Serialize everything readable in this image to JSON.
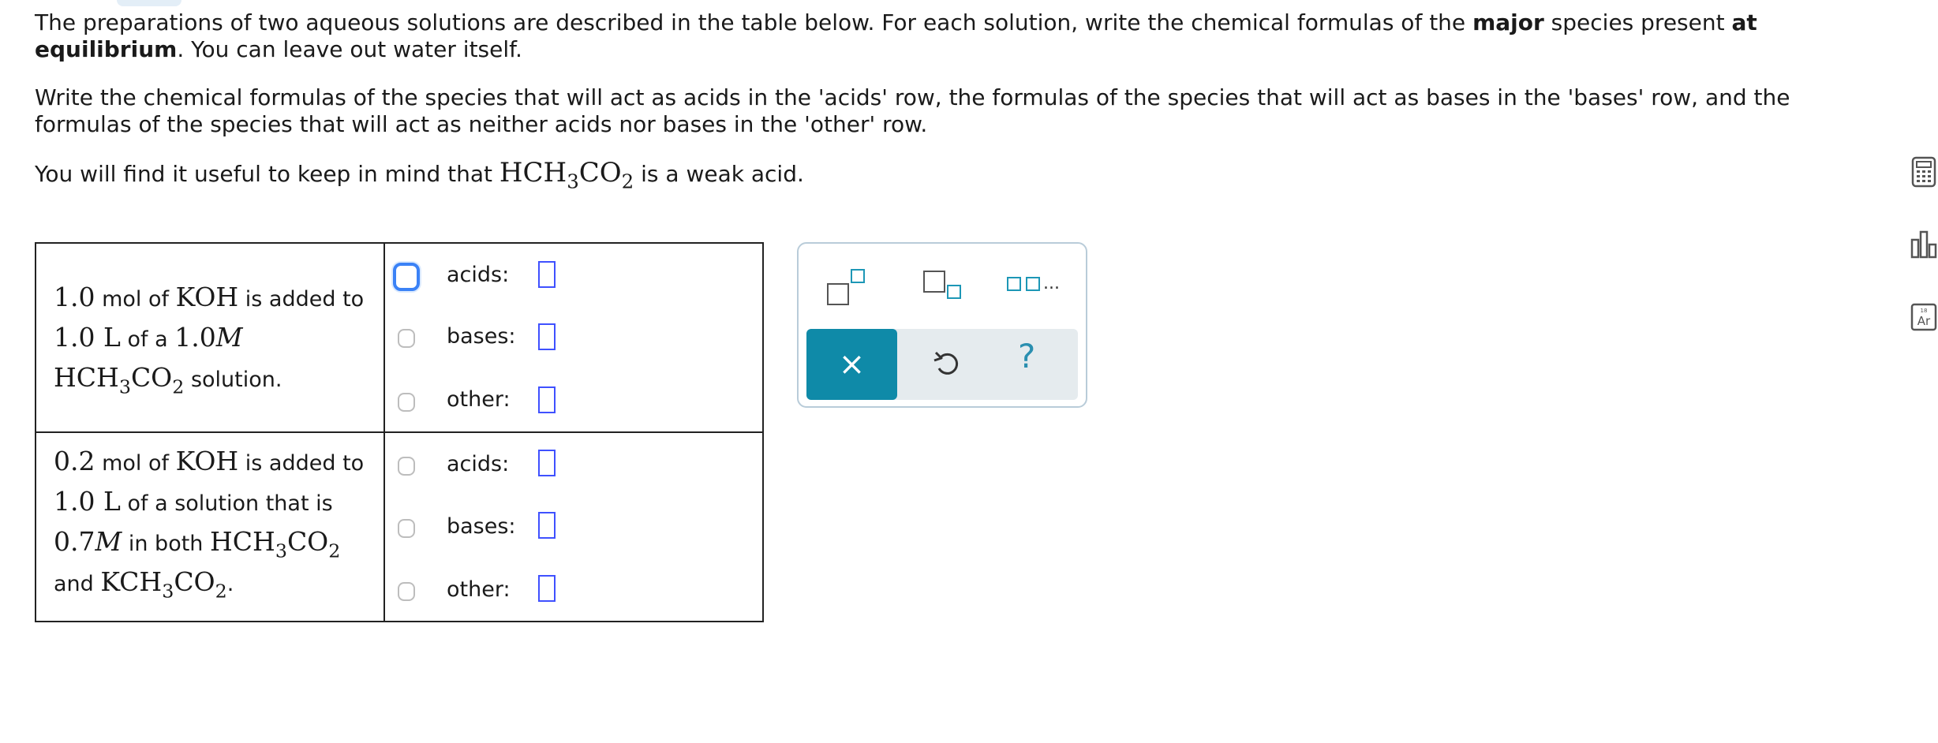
{
  "intro": {
    "p1_a": "The preparations of two aqueous solutions are described in the table below. For each solution, write the chemical formulas of the ",
    "p1_bold1": "major",
    "p1_b": " species present ",
    "p1_bold2": "at equilibrium",
    "p1_c": ". You can leave out water itself.",
    "p2": "Write the chemical formulas of the species that will act as acids in the 'acids' row, the formulas of the species that will act as bases in the 'bases' row, and the formulas of the species that will act as neither acids nor bases in the 'other' row.",
    "p3_a": "You will find it useful to keep in mind that ",
    "p3_formula_main": "HCH",
    "p3_sub1": "3",
    "p3_formula_mid": "CO",
    "p3_sub2": "2",
    "p3_b": " is a weak acid."
  },
  "table": {
    "solution1": {
      "amount": "1.0",
      "t1": " mol of ",
      "base": "KOH",
      "t2": " is added to",
      "vol": "1.0 L",
      "t3": " of a ",
      "conc": "1.0",
      "M": "M",
      "acid_a": "HCH",
      "acid_s1": "3",
      "acid_b": "CO",
      "acid_s2": "2",
      "t4": " solution."
    },
    "solution2": {
      "amount": "0.2",
      "t1": " mol of ",
      "base": "KOH",
      "t2": " is added to",
      "vol": "1.0 L",
      "t3": " of a solution that is",
      "conc": "0.7",
      "M": "M",
      "t4": " in both ",
      "acid_a": "HCH",
      "acid_s1": "3",
      "acid_b": "CO",
      "acid_s2": "2",
      "t5": "and ",
      "salt_a": "KCH",
      "salt_s1": "3",
      "salt_b": "CO",
      "salt_s2": "2",
      "t6": "."
    },
    "row_labels": {
      "acids": "acids:",
      "bases": "bases:",
      "other": "other:"
    }
  },
  "palette": {
    "superscript_icon": "superscript-box-icon",
    "subscript_icon": "subscript-box-icon",
    "list_ellipsis": "...",
    "clear_symbol": "×",
    "undo_icon": "undo-icon",
    "help_symbol": "?"
  },
  "colors": {
    "accent": "#0f8aa8",
    "slot_border": "#3f51ff",
    "active_checkbox": "#3b82f6"
  }
}
